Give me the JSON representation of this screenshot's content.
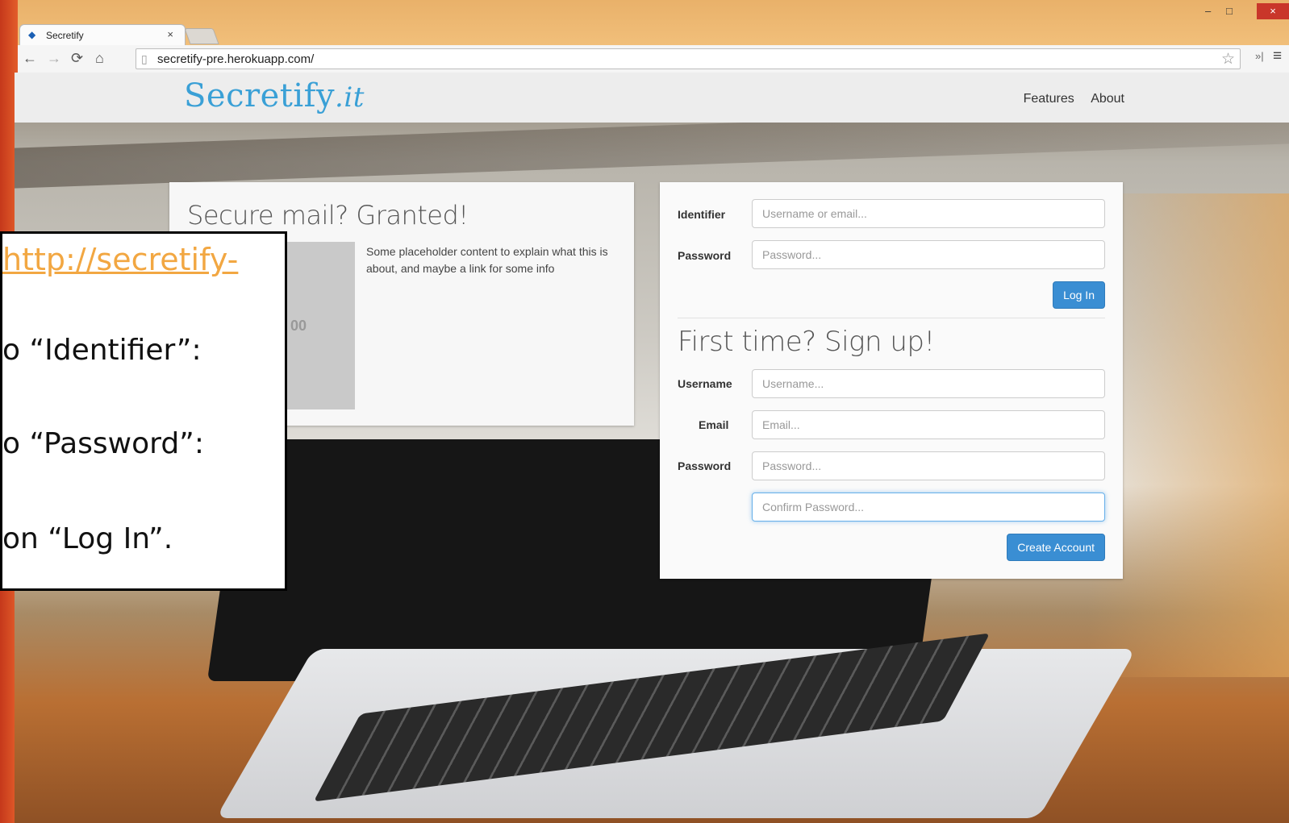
{
  "browser": {
    "tab_title": "Secretify",
    "tab_close": "×",
    "url": "secretify-pre.herokuapp.com/",
    "window_close": "×",
    "extensions_glyph": "»|",
    "menu_glyph": "≡"
  },
  "site": {
    "brand_main": "Secretify",
    "brand_suffix": ".it",
    "nav": [
      "Features",
      "About"
    ]
  },
  "hero_card": {
    "title": "Secure mail? Granted!",
    "placeholder_fragment": "00",
    "text": "Some placeholder content to explain what this is about, and maybe a link for some info"
  },
  "login": {
    "identifier_label": "Identifier",
    "identifier_placeholder": "Username or email...",
    "password_label": "Password",
    "password_placeholder": "Password...",
    "button": "Log In"
  },
  "signup": {
    "title": "First time? Sign up!",
    "username_label": "Username",
    "username_placeholder": "Username...",
    "email_label": "Email",
    "email_placeholder": "Email...",
    "password_label": "Password",
    "password_placeholder": "Password...",
    "confirm_placeholder": "Confirm Password...",
    "button": "Create Account"
  },
  "callout": {
    "link": "http://secretify-",
    "step1": "o “Identifier”:",
    "step2": "o “Password”:",
    "step3": "on “Log In”."
  },
  "colors": {
    "brand": "#3aa0d6",
    "button": "#3a8ed3",
    "callout_link": "#f2a742"
  }
}
